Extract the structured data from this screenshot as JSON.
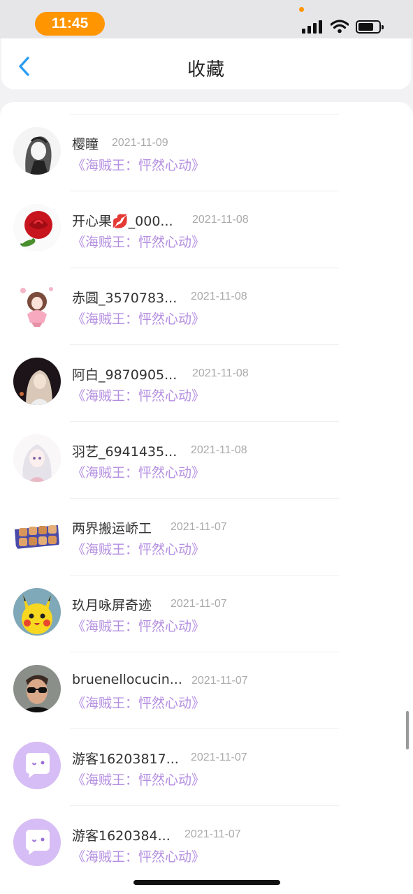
{
  "status_bar": {
    "time": "11:45"
  },
  "header": {
    "title": "收藏",
    "back_icon": "chevron-left-icon"
  },
  "colors": {
    "accent": "#2a9df4",
    "title_purple": "#b48ee0",
    "time_pill": "#ff9500"
  },
  "list": [
    {
      "name": "樱瞳",
      "date": "2021-11-09",
      "title": "《海贼王：怦然心动》",
      "avatar": "anime-sketch-avatar"
    },
    {
      "name": "开心果💋_000...",
      "date": "2021-11-08",
      "title": "《海贼王：怦然心动》",
      "avatar": "rose-avatar"
    },
    {
      "name": "赤圆_3570783...",
      "date": "2021-11-08",
      "title": "《海贼王：怦然心动》",
      "avatar": "anime-pink-avatar"
    },
    {
      "name": "阿白_9870905...",
      "date": "2021-11-08",
      "title": "《海贼王：怦然心动》",
      "avatar": "dark-portrait-avatar"
    },
    {
      "name": "羽艺_6941435...",
      "date": "2021-11-08",
      "title": "《海贼王：怦然心动》",
      "avatar": "anime-silver-hair-avatar"
    },
    {
      "name": "两界搬运峤工",
      "date": "2021-11-07",
      "title": "《海贼王：怦然心动》",
      "avatar": "food-tray-avatar"
    },
    {
      "name": "玖月咏屏奇迹",
      "date": "2021-11-07",
      "title": "《海贼王：怦然心动》",
      "avatar": "pikachu-avatar"
    },
    {
      "name": "bruenellocucin...",
      "date": "2021-11-07",
      "title": "《海贼王：怦然心动》",
      "avatar": "sunglasses-man-avatar"
    },
    {
      "name": "游客16203817...",
      "date": "2021-11-07",
      "title": "《海贼王：怦然心动》",
      "avatar": "guest-chat-avatar"
    },
    {
      "name": "游客1620384...",
      "date": "2021-11-07",
      "title": "《海贼王：怦然心动》",
      "avatar": "guest-chat-avatar"
    }
  ]
}
